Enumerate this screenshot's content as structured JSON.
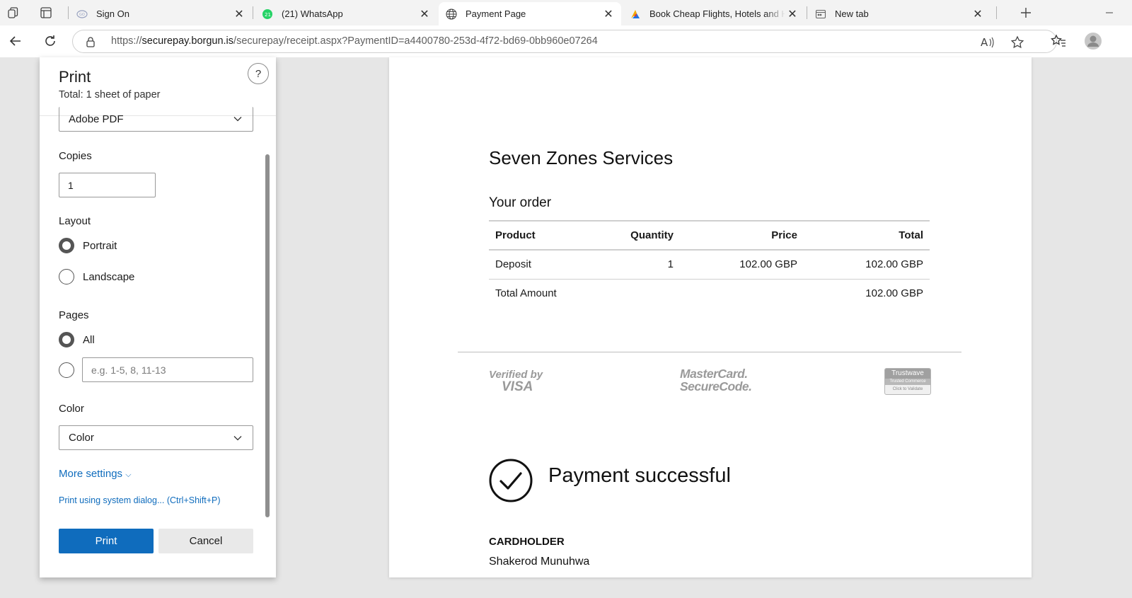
{
  "browser": {
    "tabs": [
      {
        "title": "Sign On",
        "favicon": "globe-ring-icon"
      },
      {
        "title": "(21) WhatsApp",
        "favicon": "whatsapp-icon"
      },
      {
        "title": "Payment Page",
        "favicon": "globe-icon"
      },
      {
        "title": "Book Cheap Flights, Hotels and H",
        "favicon": "travel-logo-icon"
      },
      {
        "title": "New tab",
        "favicon": "new-tab-icon"
      }
    ],
    "url_prefix": "https://",
    "url_host": "securepay.borgun.is",
    "url_path": "/securepay/receipt.aspx?PaymentID=a4400780-253d-4f72-bd69-0bb960e07264"
  },
  "print": {
    "title": "Print",
    "subtitle": "Total: 1 sheet of paper",
    "help": "?",
    "printer": "Adobe PDF",
    "copies_label": "Copies",
    "copies_value": "1",
    "layout_label": "Layout",
    "portrait": "Portrait",
    "landscape": "Landscape",
    "pages_label": "Pages",
    "pages_all": "All",
    "pages_placeholder": "e.g. 1-5, 8, 11-13",
    "color_label": "Color",
    "color_value": "Color",
    "more_settings": "More settings",
    "system_dialog": "Print using system dialog... (Ctrl+Shift+P)",
    "print_button": "Print",
    "cancel_button": "Cancel"
  },
  "receipt": {
    "merchant": "Seven Zones Services",
    "order_heading": "Your order",
    "columns": [
      "Product",
      "Quantity",
      "Price",
      "Total"
    ],
    "rows": [
      {
        "product": "Deposit",
        "quantity": "1",
        "price": "102.00 GBP",
        "total": "102.00 GBP"
      }
    ],
    "total_label": "Total Amount",
    "total_value": "102.00 GBP",
    "badges": {
      "visa_line1": "Verified by",
      "visa_line2": "VISA",
      "mc_line1": "MasterCard.",
      "mc_line2": "SecureCode.",
      "tw_line1": "Trustwave",
      "tw_line2": "Trusted Commerce",
      "tw_line3": "Click to Validate"
    },
    "status": "Payment successful",
    "cardholder_label": "CARDHOLDER",
    "cardholder_name": "Shakerod Munuhwa"
  },
  "colors": {
    "accent": "#0f6cbd",
    "whatsapp_green": "#25d366"
  }
}
